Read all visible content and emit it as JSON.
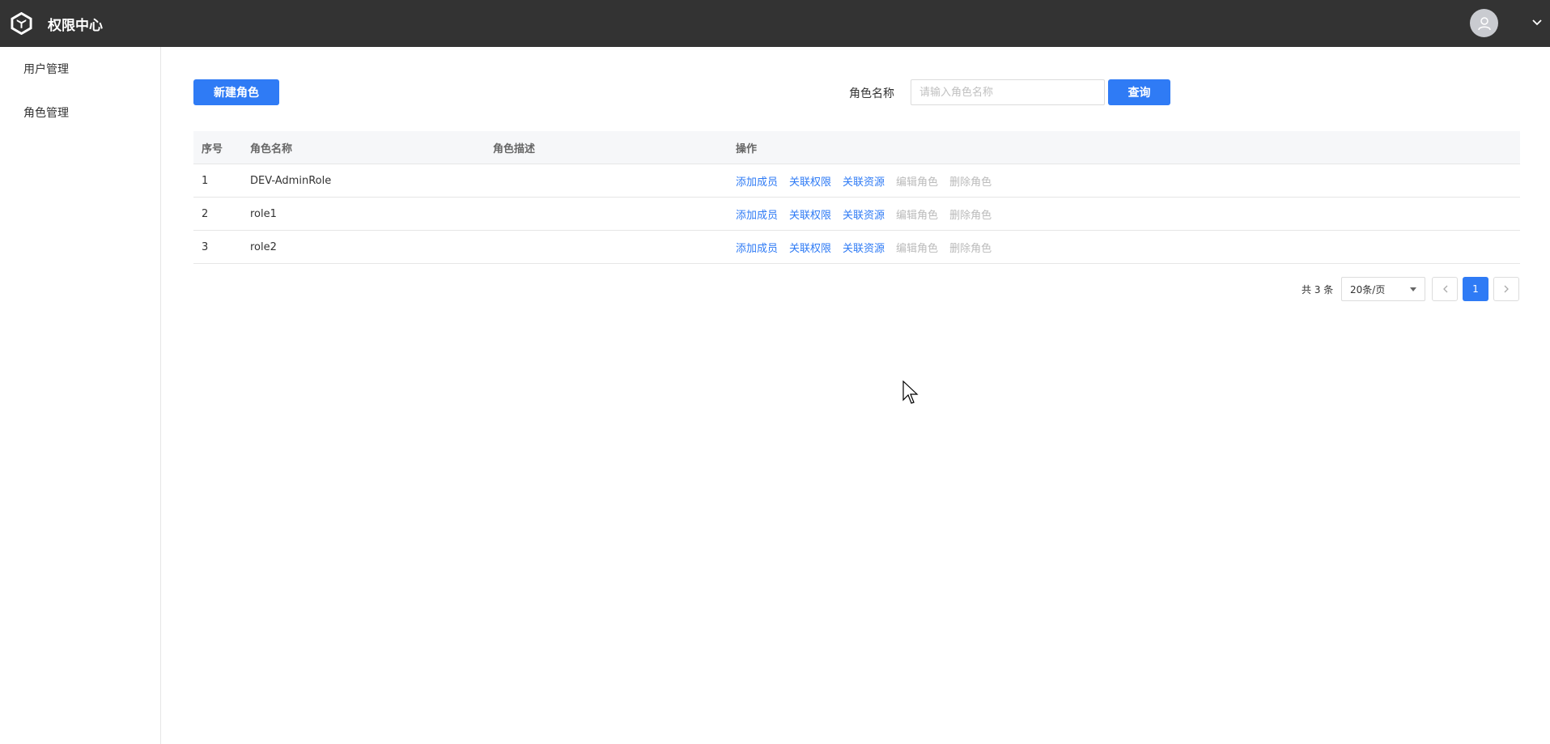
{
  "app": {
    "title": "权限中心"
  },
  "sidebar": {
    "items": [
      {
        "label": "用户管理"
      },
      {
        "label": "角色管理"
      }
    ]
  },
  "toolbar": {
    "new_role_label": "新建角色",
    "filter_label": "角色名称",
    "search_placeholder": "请输入角色名称",
    "search_value": "",
    "query_label": "查询"
  },
  "table": {
    "columns": [
      "序号",
      "角色名称",
      "角色描述",
      "操作"
    ],
    "rows": [
      {
        "index": "1",
        "name": "DEV-AdminRole",
        "desc": ""
      },
      {
        "index": "2",
        "name": "role1",
        "desc": ""
      },
      {
        "index": "3",
        "name": "role2",
        "desc": ""
      }
    ],
    "actions": [
      "添加成员",
      "关联权限",
      "关联资源",
      "编辑角色",
      "删除角色"
    ]
  },
  "pagination": {
    "total_text": "共 3 条",
    "page_size": "20条/页",
    "current_page": "1"
  },
  "colors": {
    "topbar": "#333333",
    "accent": "#2f7bf5",
    "disabled": "#bbbbbb"
  },
  "icons": [
    "logo-icon",
    "avatar-icon",
    "chevron-down-icon",
    "caret-down-icon",
    "chevron-left-icon",
    "chevron-right-icon",
    "mouse-cursor-icon"
  ]
}
